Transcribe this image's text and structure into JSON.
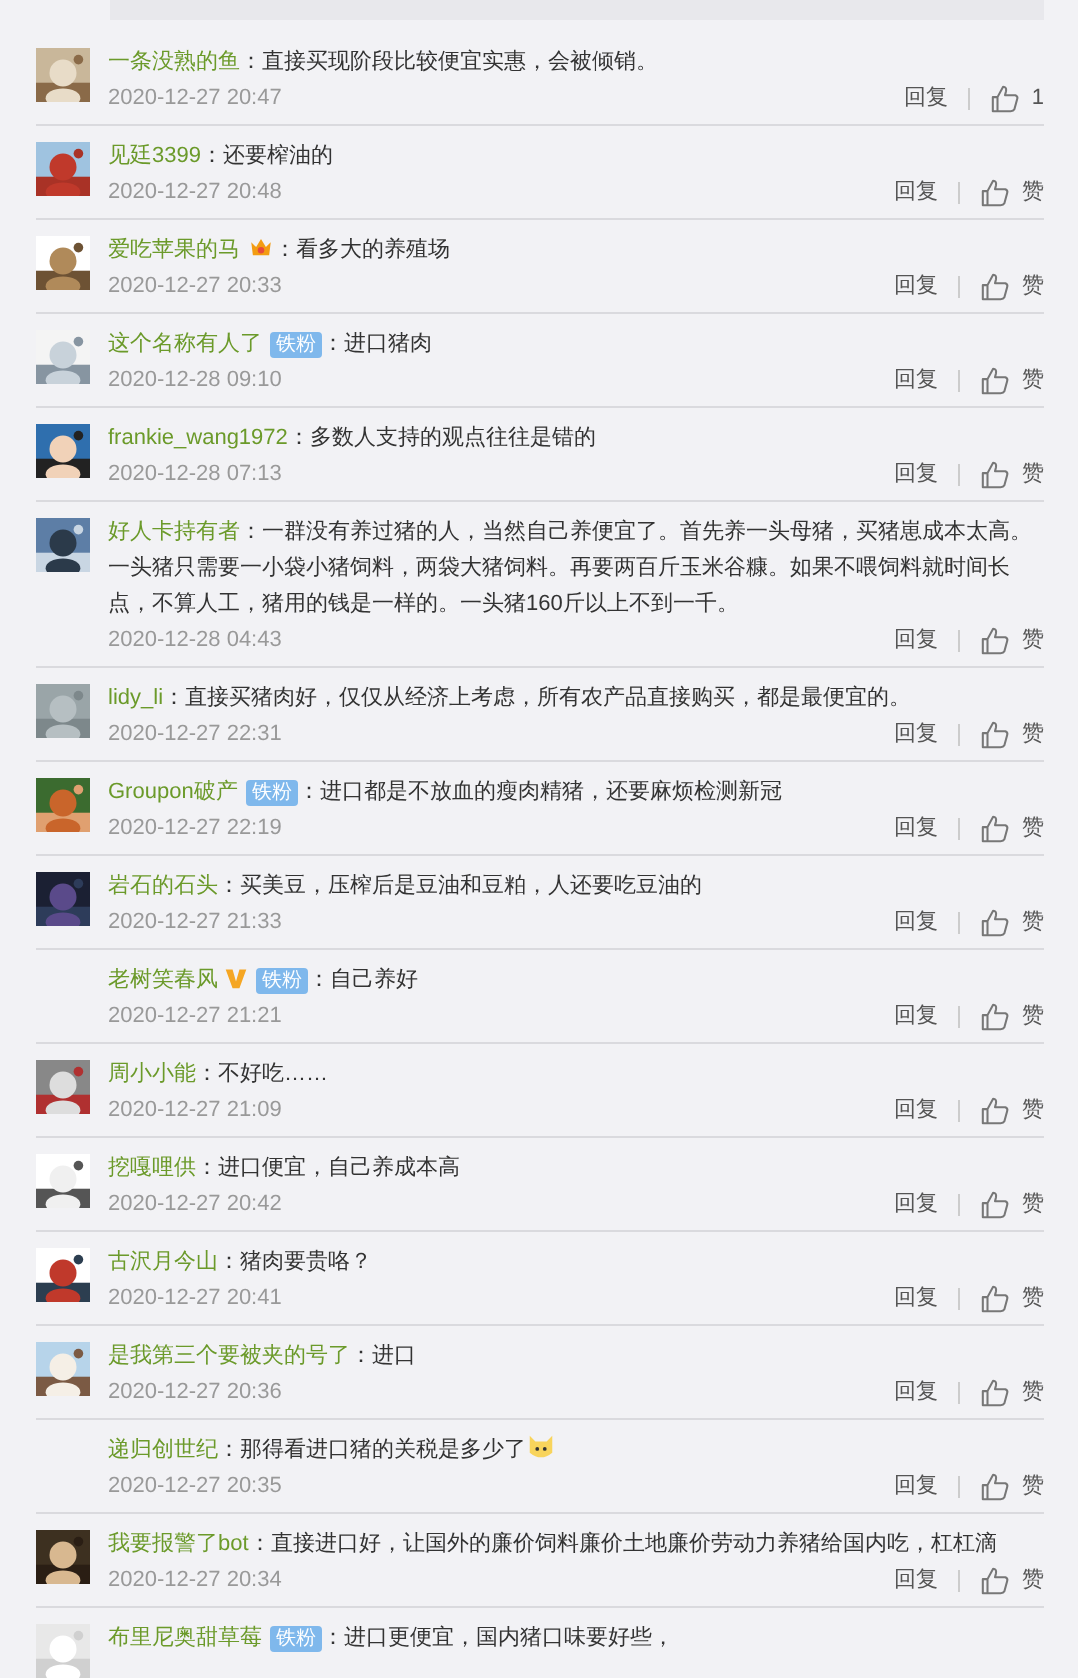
{
  "comments": [
    {
      "avatar": true,
      "name": "一条没熟的鱼",
      "text": "：直接买现阶段比较便宜实惠，会被倾销。",
      "emoji": false,
      "time": "2020-12-27 20:47",
      "reply": "回复",
      "like": "1"
    },
    {
      "avatar": true,
      "name": "见廷3399",
      "text": "：还要榨油的",
      "emoji": false,
      "time": "2020-12-27 20:48",
      "reply": "回复",
      "like": "赞"
    },
    {
      "avatar": true,
      "name": "爱吃苹果的马",
      "badges": [
        {
          "kind": "crown"
        }
      ],
      "text": "：看多大的养殖场",
      "emoji": false,
      "time": "2020-12-27 20:33",
      "reply": "回复",
      "like": "赞"
    },
    {
      "avatar": true,
      "name": "这个名称有人了",
      "badges": [
        {
          "kind": "fan",
          "label": "铁粉"
        }
      ],
      "text": "：进口猪肉",
      "emoji": false,
      "time": "2020-12-28 09:10",
      "reply": "回复",
      "like": "赞"
    },
    {
      "avatar": true,
      "name": "frankie_wang1972",
      "text": "：多数人支持的观点往往是错的",
      "emoji": false,
      "time": "2020-12-28 07:13",
      "reply": "回复",
      "like": "赞"
    },
    {
      "avatar": true,
      "name": "好人卡持有者",
      "text": "：一群没有养过猪的人，当然自己养便宜了。首先养一头母猪，买猪崽成本太高。一头猪只需要一小袋小猪饲料，两袋大猪饲料。再要两百斤玉米谷糠。如果不喂饲料就时间长点，不算人工，猪用的钱是一样的。一头猪160斤以上不到一千。",
      "emoji": false,
      "time": "2020-12-28 04:43",
      "reply": "回复",
      "like": "赞"
    },
    {
      "avatar": true,
      "name": "lidy_li",
      "text": "：直接买猪肉好，仅仅从经济上考虑，所有农产品直接购买，都是最便宜的。",
      "emoji": false,
      "time": "2020-12-27 22:31",
      "reply": "回复",
      "like": "赞"
    },
    {
      "avatar": true,
      "name": "Groupon破产",
      "badges": [
        {
          "kind": "fan",
          "label": "铁粉"
        }
      ],
      "text": "：进口都是不放血的瘦肉精猪，还要麻烦检测新冠",
      "emoji": false,
      "time": "2020-12-27 22:19",
      "reply": "回复",
      "like": "赞"
    },
    {
      "avatar": true,
      "name": "岩石的石头",
      "text": "：买美豆，压榨后是豆油和豆粕，人还要吃豆油的",
      "emoji": false,
      "time": "2020-12-27 21:33",
      "reply": "回复",
      "like": "赞"
    },
    {
      "avatar": false,
      "name": "老树笑春风",
      "badges": [
        {
          "kind": "verified"
        },
        {
          "kind": "fan",
          "label": "铁粉"
        }
      ],
      "text": "：自己养好",
      "emoji": false,
      "time": "2020-12-27 21:21",
      "reply": "回复",
      "like": "赞"
    },
    {
      "avatar": true,
      "name": "周小小能",
      "text": "：不好吃……",
      "emoji": false,
      "time": "2020-12-27 21:09",
      "reply": "回复",
      "like": "赞"
    },
    {
      "avatar": true,
      "name": "挖嘎哩供",
      "text": "：进口便宜，自己养成本高",
      "emoji": false,
      "time": "2020-12-27 20:42",
      "reply": "回复",
      "like": "赞"
    },
    {
      "avatar": true,
      "name": "古沢月今山",
      "text": "：猪肉要贵咯？",
      "emoji": false,
      "time": "2020-12-27 20:41",
      "reply": "回复",
      "like": "赞"
    },
    {
      "avatar": true,
      "name": "是我第三个要被夹的号了",
      "text": "：进口",
      "emoji": false,
      "time": "2020-12-27 20:36",
      "reply": "回复",
      "like": "赞"
    },
    {
      "avatar": false,
      "name": "递归创世纪",
      "text": "：那得看进口猪的关税是多少了",
      "emoji": true,
      "time": "2020-12-27 20:35",
      "reply": "回复",
      "like": "赞"
    },
    {
      "avatar": true,
      "name": "我要报警了bot",
      "text": "：直接进口好，让国外的廉价饲料廉价土地廉价劳动力养猪给国内吃，杠杠滴",
      "emoji": false,
      "time": "2020-12-27 20:34",
      "reply": "回复",
      "like": "赞"
    },
    {
      "avatar": true,
      "name": "布里尼奥甜草莓",
      "badges": [
        {
          "kind": "fan",
          "label": "铁粉"
        }
      ],
      "text": "：进口更便宜，国内猪口味要好些，",
      "emoji": false
    }
  ]
}
